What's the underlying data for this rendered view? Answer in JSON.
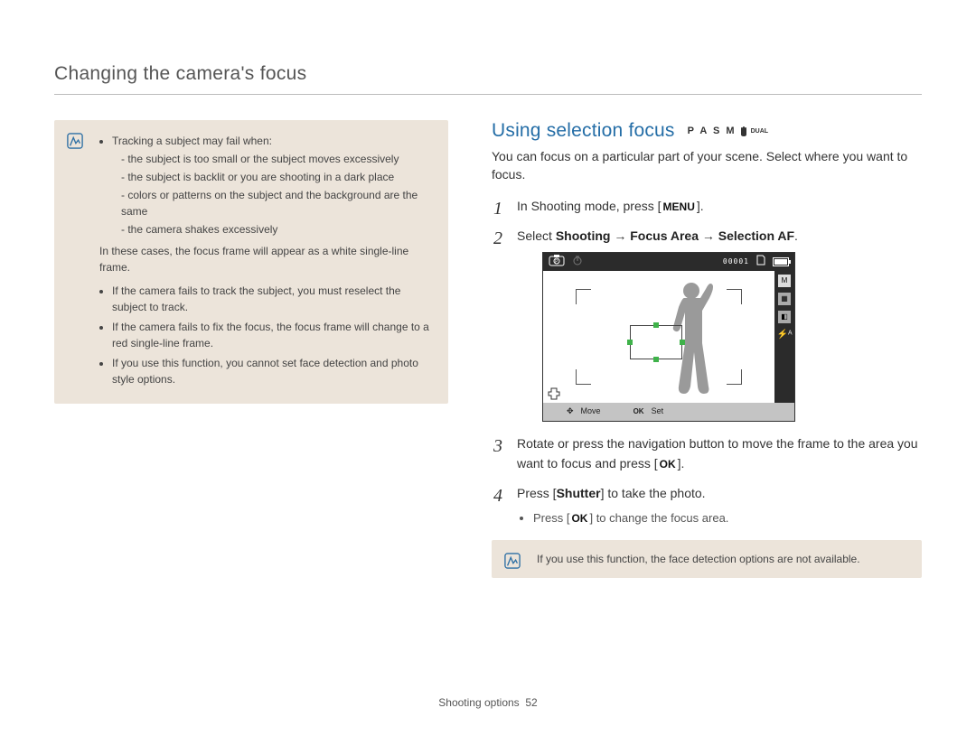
{
  "header": "Changing the camera's focus",
  "footer_section": "Shooting options",
  "footer_page": "52",
  "note_left": {
    "lead": "Tracking a subject may fail when:",
    "reasons": [
      "the subject is too small or the subject moves excessively",
      "the subject is backlit or you are shooting in a dark place",
      "colors or patterns on the subject and the background are the same",
      "the camera shakes excessively"
    ],
    "consequence": "In these cases, the focus frame will appear as a white single-line frame.",
    "more": [
      "If the camera fails to track the subject, you must reselect the subject to track.",
      "If the camera fails to fix the focus, the focus frame will change to a red single-line frame.",
      "If you use this function, you cannot set face detection and photo style options."
    ]
  },
  "section_title": "Using selection focus",
  "mode_icons_text": "P A S M",
  "mode_dual": "DUAL",
  "intro": "You can focus on a particular part of your scene. Select where you want to focus.",
  "steps": {
    "s1_a": "In Shooting mode, press [",
    "s1_btn": "MENU",
    "s1_b": "].",
    "s2_a": "Select ",
    "s2_b": "Shooting",
    "s2_c": " → ",
    "s2_d": "Focus Area",
    "s2_e": " → ",
    "s2_f": "Selection AF",
    "s2_g": ".",
    "s3_a": "Rotate or press the navigation button to move the frame to the area you want to focus and press [",
    "s3_btn": "OK",
    "s3_b": "].",
    "s4_a": "Press [",
    "s4_btn": "Shutter",
    "s4_b": "] to take the photo.",
    "s4_sub_a": "Press [",
    "s4_sub_btn": "OK",
    "s4_sub_b": "] to change the focus area."
  },
  "lcd": {
    "counter": "00001",
    "bottom_move": "Move",
    "bottom_set": "Set",
    "bottom_ok": "OK",
    "right_icons": [
      "M",
      "▦",
      "◧",
      "⚡ᴬ"
    ]
  },
  "note_right": "If you use this function, the face detection options are not available."
}
